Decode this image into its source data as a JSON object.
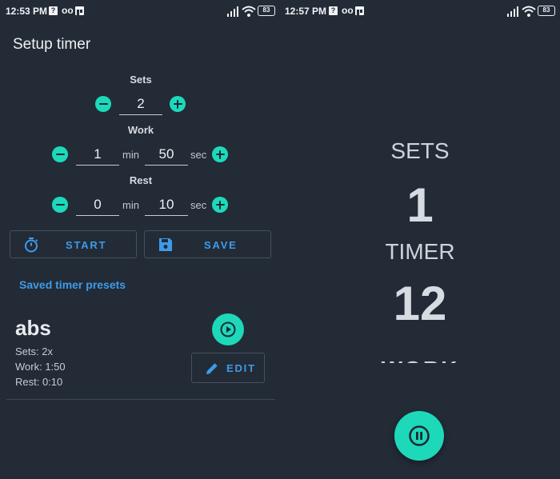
{
  "left_screen": {
    "status": {
      "time": "12:53 PM",
      "battery": "83",
      "icons": [
        "help-icon",
        "voicemail-icon",
        "book-icon",
        "signal-icon",
        "wifi-icon",
        "battery-icon"
      ]
    },
    "title": "Setup timer",
    "sets": {
      "label": "Sets",
      "value": "2"
    },
    "work": {
      "label": "Work",
      "minutes": "1",
      "seconds": "50",
      "min_unit": "min",
      "sec_unit": "sec"
    },
    "rest": {
      "label": "Rest",
      "minutes": "0",
      "seconds": "10",
      "min_unit": "min",
      "sec_unit": "sec"
    },
    "start_button": {
      "label": "START",
      "icon": "stopwatch-icon"
    },
    "save_button": {
      "label": "SAVE",
      "icon": "floppy-disk-icon"
    },
    "presets": {
      "heading": "Saved timer presets",
      "items": [
        {
          "name": "abs",
          "sets": "Sets: 2x",
          "work": "Work: 1:50",
          "rest": "Rest: 0:10",
          "edit_label": "EDIT"
        }
      ]
    }
  },
  "right_screen": {
    "status": {
      "time": "12:57 PM",
      "battery": "83"
    },
    "sets_label": "SETS",
    "sets_value": "1",
    "timer_label": "TIMER",
    "timer_value": "12",
    "phase_label": "WORK"
  },
  "colors": {
    "background": "#232b37",
    "accent": "#1dd9ba",
    "link": "#3d9be9"
  }
}
